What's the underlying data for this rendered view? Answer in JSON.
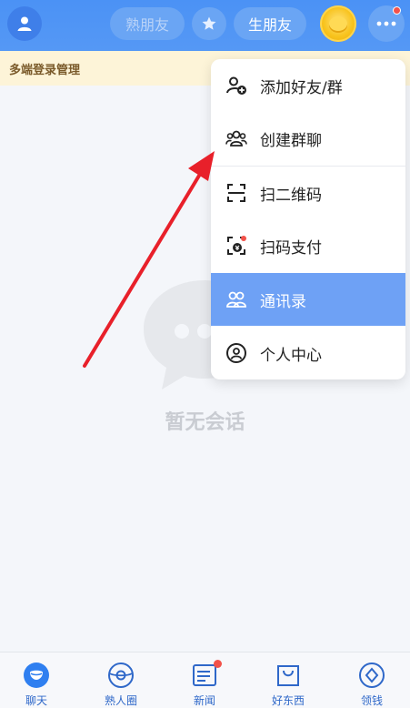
{
  "header": {
    "tab_shu": "熟朋友",
    "tab_sheng": "生朋友",
    "colors": {
      "bar": "#4b92f5",
      "pill": "#6aa5f4",
      "badge": "#f2524a"
    }
  },
  "notice": {
    "text": "多端登录管理"
  },
  "empty": {
    "text": "暂无会话"
  },
  "menu": {
    "items": [
      {
        "label": "添加好友/群",
        "icon": "add-friend-icon"
      },
      {
        "label": "创建群聊",
        "icon": "group-chat-icon"
      },
      {
        "label": "扫二维码",
        "icon": "scan-qr-icon"
      },
      {
        "label": "扫码支付",
        "icon": "scan-pay-icon"
      },
      {
        "label": "通讯录",
        "icon": "contacts-icon",
        "active": true
      },
      {
        "label": "个人中心",
        "icon": "profile-icon"
      }
    ]
  },
  "bottom_nav": {
    "items": [
      {
        "label": "聊天",
        "icon": "chat-icon",
        "active": true
      },
      {
        "label": "熟人圈",
        "icon": "moments-icon"
      },
      {
        "label": "新闻",
        "icon": "news-icon",
        "badge": true
      },
      {
        "label": "好东西",
        "icon": "shopping-bag-icon"
      },
      {
        "label": "领钱",
        "icon": "claim-money-icon"
      }
    ]
  }
}
